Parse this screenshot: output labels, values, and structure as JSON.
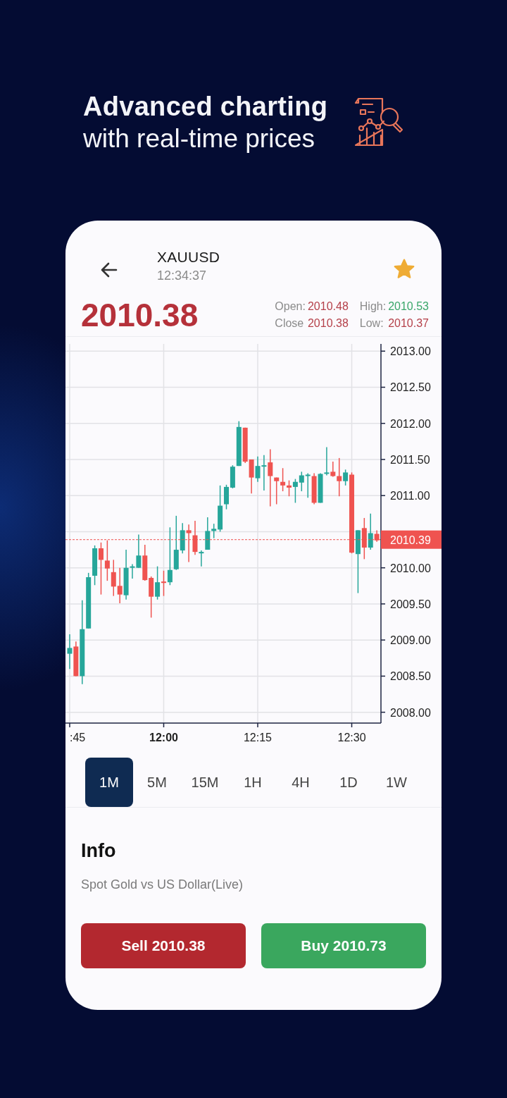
{
  "headline": {
    "title": "Advanced charting",
    "subtitle": "with real-time prices"
  },
  "header": {
    "symbol": "XAUUSD",
    "time": "12:34:37",
    "favorite": true,
    "price": "2010.38",
    "stats": [
      {
        "label": "Open:",
        "value": "2010.48",
        "color": "#b5414a"
      },
      {
        "label": "High:",
        "value": "2010.53",
        "color": "#3aa76a"
      },
      {
        "label": "Close",
        "value": "2010.38",
        "color": "#b5414a"
      },
      {
        "label": "Low:",
        "value": "2010.37",
        "color": "#b5414a"
      }
    ]
  },
  "chart": {
    "xtick_bold": [
      false,
      true,
      false,
      false
    ],
    "chart_data": {
      "type": "candlestick",
      "grid": true,
      "ylim": [
        2007.85,
        2013.1
      ],
      "categories": [
        ":45",
        null,
        null,
        null,
        null,
        null,
        null,
        null,
        null,
        null,
        null,
        null,
        null,
        null,
        null,
        "12:00",
        null,
        null,
        null,
        null,
        null,
        null,
        null,
        null,
        null,
        null,
        null,
        null,
        null,
        null,
        "12:15",
        null,
        null,
        null,
        null,
        null,
        null,
        null,
        null,
        null,
        null,
        null,
        null,
        null,
        null,
        "12:30",
        null,
        null,
        null,
        null
      ],
      "yticks": [
        {
          "value": 2008,
          "label": "2008.00"
        },
        {
          "value": 2008.5,
          "label": "2008.50"
        },
        {
          "value": 2009,
          "label": "2009.00"
        },
        {
          "value": 2009.5,
          "label": "2009.50"
        },
        {
          "value": 2010,
          "label": "2010.00"
        },
        {
          "value": 2011,
          "label": "2011.00"
        },
        {
          "value": 2011.5,
          "label": "2011.50"
        },
        {
          "value": 2012,
          "label": "2012.00"
        },
        {
          "value": 2012.5,
          "label": "2012.50"
        },
        {
          "value": 2013,
          "label": "2013.00"
        }
      ],
      "ref_lines": [
        {
          "axis": "y",
          "value": 2010.39,
          "label": "2010.39"
        }
      ],
      "ohlc": [
        [
          2008.81,
          2009.08,
          2008.6,
          2008.89
        ],
        [
          2008.91,
          2008.98,
          2008.5,
          2008.5
        ],
        [
          2008.5,
          2009.55,
          2008.39,
          2009.15
        ],
        [
          2009.16,
          2009.93,
          2009.16,
          2009.87
        ],
        [
          2009.89,
          2010.31,
          2009.76,
          2010.27
        ],
        [
          2010.27,
          2010.35,
          2009.63,
          2010.11
        ],
        [
          2010.1,
          2010.38,
          2009.82,
          2009.99
        ],
        [
          2009.94,
          2010.11,
          2009.61,
          2009.74
        ],
        [
          2009.75,
          2010.0,
          2009.51,
          2009.63
        ],
        [
          2009.62,
          2010.25,
          2009.56,
          2010.0
        ],
        [
          2010.01,
          2010.05,
          2009.85,
          2010.02
        ],
        [
          2010.0,
          2010.46,
          2010.0,
          2010.17
        ],
        [
          2010.17,
          2010.32,
          2009.82,
          2009.83
        ],
        [
          2009.86,
          2009.88,
          2009.31,
          2009.6
        ],
        [
          2009.6,
          2010.02,
          2009.56,
          2009.8
        ],
        [
          2009.81,
          2009.96,
          2009.61,
          2009.79
        ],
        [
          2009.8,
          2010.56,
          2009.76,
          2009.97
        ],
        [
          2009.98,
          2010.72,
          2009.97,
          2010.25
        ],
        [
          2010.24,
          2010.62,
          2010.2,
          2010.52
        ],
        [
          2010.52,
          2010.6,
          2010.08,
          2010.48
        ],
        [
          2010.45,
          2010.65,
          2010.18,
          2010.22
        ],
        [
          2010.2,
          2010.24,
          2010.02,
          2010.22
        ],
        [
          2010.25,
          2010.7,
          2010.25,
          2010.51
        ],
        [
          2010.51,
          2010.61,
          2010.41,
          2010.54
        ],
        [
          2010.53,
          2011.14,
          2010.5,
          2010.86
        ],
        [
          2010.88,
          2011.15,
          2010.81,
          2011.12
        ],
        [
          2011.11,
          2011.42,
          2011.1,
          2011.4
        ],
        [
          2011.41,
          2012.03,
          2011.41,
          2011.95
        ],
        [
          2011.94,
          2011.94,
          2011.45,
          2011.47
        ],
        [
          2011.5,
          2011.5,
          2011.03,
          2011.25
        ],
        [
          2011.24,
          2011.54,
          2011.19,
          2011.41
        ],
        [
          2011.41,
          2011.56,
          2011.07,
          2011.42
        ],
        [
          2011.46,
          2011.64,
          2010.85,
          2011.27
        ],
        [
          2011.25,
          2011.25,
          2010.88,
          2011.2
        ],
        [
          2011.19,
          2011.38,
          2011.06,
          2011.14
        ],
        [
          2011.14,
          2011.21,
          2010.99,
          2011.11
        ],
        [
          2011.12,
          2011.23,
          2010.9,
          2011.19
        ],
        [
          2011.18,
          2011.33,
          2011.06,
          2011.28
        ],
        [
          2011.28,
          2011.31,
          2010.97,
          2011.29
        ],
        [
          2011.27,
          2011.31,
          2010.88,
          2010.9
        ],
        [
          2010.9,
          2011.31,
          2010.9,
          2011.3
        ],
        [
          2011.31,
          2011.67,
          2011.28,
          2011.32
        ],
        [
          2011.33,
          2011.47,
          2011.26,
          2011.27
        ],
        [
          2011.27,
          2011.52,
          2010.99,
          2011.2
        ],
        [
          2011.2,
          2011.36,
          2011.14,
          2011.32
        ],
        [
          2011.29,
          2011.32,
          2010.2,
          2010.21
        ],
        [
          2010.19,
          2010.52,
          2009.65,
          2010.52
        ],
        [
          2010.55,
          2010.69,
          2010.12,
          2010.28
        ],
        [
          2010.28,
          2010.75,
          2010.25,
          2010.48
        ],
        [
          2010.47,
          2010.52,
          2010.36,
          2010.38
        ]
      ]
    }
  },
  "timeframes": [
    {
      "label": "1M",
      "selected": true
    },
    {
      "label": "5M",
      "selected": false
    },
    {
      "label": "15M",
      "selected": false
    },
    {
      "label": "1H",
      "selected": false
    },
    {
      "label": "4H",
      "selected": false
    },
    {
      "label": "1D",
      "selected": false
    },
    {
      "label": "1W",
      "selected": false
    }
  ],
  "info": {
    "title": "Info",
    "description": "Spot Gold vs US Dollar(Live)"
  },
  "actions": [
    {
      "label": "Sell 2010.38",
      "kind": "sell"
    },
    {
      "label": "Buy 2010.73",
      "kind": "buy"
    }
  ]
}
